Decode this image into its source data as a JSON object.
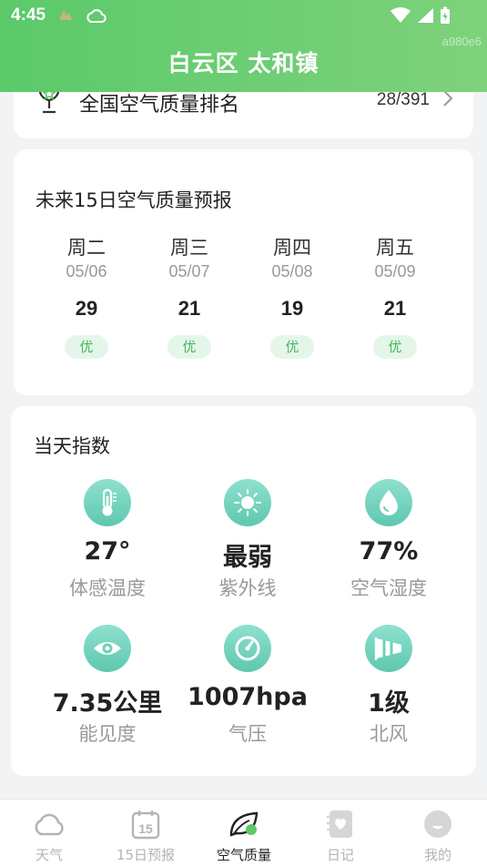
{
  "status_bar": {
    "time": "4:45"
  },
  "watermark": "a980e6",
  "header": {
    "title": "白云区 太和镇"
  },
  "rank": {
    "label": "全国空气质量排名",
    "value": "28/391"
  },
  "forecast": {
    "title": "未来15日空气质量预报",
    "days": [
      {
        "name": "周二",
        "date": "05/06",
        "value": "29",
        "level": "优"
      },
      {
        "name": "周三",
        "date": "05/07",
        "value": "21",
        "level": "优"
      },
      {
        "name": "周四",
        "date": "05/08",
        "value": "19",
        "level": "优"
      },
      {
        "name": "周五",
        "date": "05/09",
        "value": "21",
        "level": "优"
      }
    ]
  },
  "today_index": {
    "title": "当天指数",
    "items": [
      {
        "icon": "thermometer-icon",
        "value": "27°",
        "label": "体感温度"
      },
      {
        "icon": "sun-icon",
        "value": "最弱",
        "label": "紫外线"
      },
      {
        "icon": "droplet-icon",
        "value": "77%",
        "label": "空气湿度"
      },
      {
        "icon": "eye-icon",
        "value": "7.35公里",
        "label": "能见度"
      },
      {
        "icon": "gauge-icon",
        "value": "1007hpa",
        "label": "气压"
      },
      {
        "icon": "windsock-icon",
        "value": "1级",
        "label": "北风"
      }
    ]
  },
  "nav": {
    "items": [
      {
        "label": "天气",
        "icon": "cloud-icon"
      },
      {
        "label": "15日预报",
        "icon": "calendar-15-icon"
      },
      {
        "label": "空气质量",
        "icon": "leaf-icon"
      },
      {
        "label": "日记",
        "icon": "diary-icon"
      },
      {
        "label": "我的",
        "icon": "profile-icon"
      }
    ],
    "active": "空气质量"
  },
  "colors": {
    "header_start": "#5bc96a",
    "header_end": "#7ed27c",
    "badge_text": "#45b65b",
    "icon_bg": "#6dd0b8"
  }
}
